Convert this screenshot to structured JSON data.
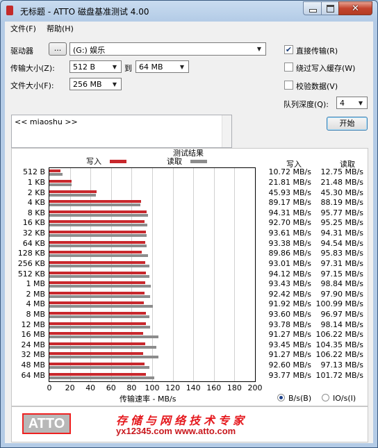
{
  "window": {
    "title": "无标题 - ATTO 磁盘基准测试 4.00"
  },
  "menu": [
    {
      "label": "文件(F)"
    },
    {
      "label": "帮助(H)"
    }
  ],
  "form": {
    "drive_label": "驱动器",
    "browse_label": "...",
    "drive_value": "(G:) 娱乐",
    "transfer_label": "传输大小(Z):",
    "transfer_from": "512 B",
    "to_label": "到",
    "transfer_to": "64 MB",
    "filesize_label": "文件大小(F):",
    "filesize_value": "256 MB",
    "direct_io_label": "直接传输(R)",
    "direct_io_checked": true,
    "bypass_cache_label": "绕过写入缓存(W)",
    "bypass_cache_checked": false,
    "verify_label": "校验数据(V)",
    "verify_checked": false,
    "queue_label": "队列深度(Q):",
    "queue_value": "4",
    "start_label": "开始",
    "notes_text": "<< miaoshu >>"
  },
  "results": {
    "title": "测试结果",
    "legend_write": "写入",
    "legend_read": "读取",
    "col_write": "写入",
    "col_read": "读取",
    "write_color": "#c8282d",
    "read_color": "#8c8c8c",
    "unit_bs_label": "B/s(B)",
    "unit_io_label": "IO/s(I)",
    "unit_selected": "B/s(B)",
    "write_values": [
      "10.72 MB/s",
      "21.81 MB/s",
      "45.93 MB/s",
      "89.17 MB/s",
      "94.31 MB/s",
      "92.70 MB/s",
      "93.61 MB/s",
      "93.38 MB/s",
      "89.86 MB/s",
      "93.01 MB/s",
      "94.12 MB/s",
      "93.43 MB/s",
      "92.42 MB/s",
      "91.92 MB/s",
      "93.60 MB/s",
      "93.78 MB/s",
      "91.27 MB/s",
      "93.45 MB/s",
      "91.27 MB/s",
      "92.60 MB/s",
      "93.77 MB/s"
    ],
    "read_values": [
      "12.75 MB/s",
      "21.48 MB/s",
      "45.30 MB/s",
      "88.19 MB/s",
      "95.77 MB/s",
      "95.25 MB/s",
      "94.31 MB/s",
      "94.54 MB/s",
      "95.83 MB/s",
      "97.31 MB/s",
      "97.15 MB/s",
      "98.84 MB/s",
      "97.90 MB/s",
      "100.99 MB/s",
      "96.97 MB/s",
      "98.14 MB/s",
      "106.22 MB/s",
      "104.35 MB/s",
      "106.22 MB/s",
      "97.13 MB/s",
      "101.72 MB/s"
    ]
  },
  "chart_data": {
    "type": "bar",
    "orientation": "horizontal",
    "categories": [
      "512 B",
      "1 KB",
      "2 KB",
      "4 KB",
      "8 KB",
      "16 KB",
      "32 KB",
      "64 KB",
      "128 KB",
      "256 KB",
      "512 KB",
      "1 MB",
      "2 MB",
      "4 MB",
      "8 MB",
      "12 MB",
      "16 MB",
      "24 MB",
      "32 MB",
      "48 MB",
      "64 MB"
    ],
    "series": [
      {
        "name": "写入",
        "color": "#c8282d",
        "values": [
          10.72,
          21.81,
          45.93,
          89.17,
          94.31,
          92.7,
          93.61,
          93.38,
          89.86,
          93.01,
          94.12,
          93.43,
          92.42,
          91.92,
          93.6,
          93.78,
          91.27,
          93.45,
          91.27,
          92.6,
          93.77
        ]
      },
      {
        "name": "读取",
        "color": "#8c8c8c",
        "values": [
          12.75,
          21.48,
          45.3,
          88.19,
          95.77,
          95.25,
          94.31,
          94.54,
          95.83,
          97.31,
          97.15,
          98.84,
          97.9,
          100.99,
          96.97,
          98.14,
          106.22,
          104.35,
          106.22,
          97.13,
          101.72
        ]
      }
    ],
    "title": "测试结果",
    "xlabel": "传输速率 - MB/s",
    "ylabel": "",
    "xlim": [
      0,
      200
    ],
    "xticks": [
      "0",
      "20",
      "40",
      "60",
      "80",
      "100",
      "120",
      "140",
      "160",
      "180",
      "200"
    ],
    "grid": true,
    "legend_position": "top"
  },
  "banner": {
    "logo_text": "ATTO",
    "promo_text": "存储与网络技术专家",
    "watermark_text": "yx12345.com",
    "url_text": "www.atto.com"
  }
}
